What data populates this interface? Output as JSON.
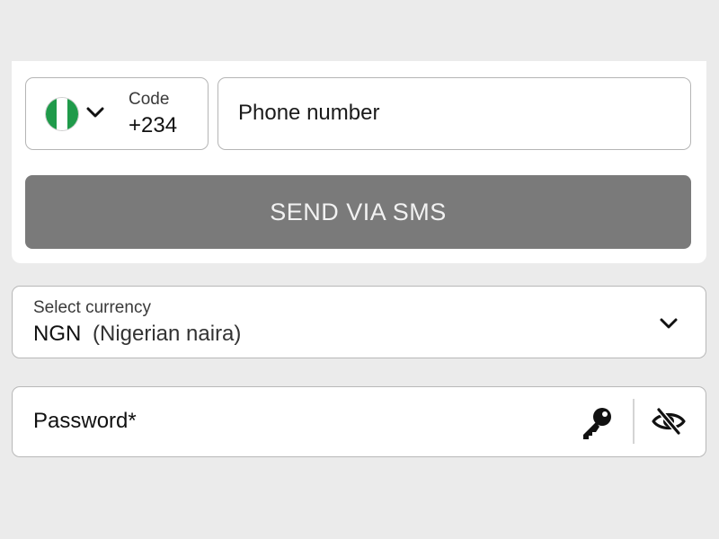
{
  "phone": {
    "code_label": "Code",
    "code_value": "+234",
    "country_flag_icon": "nigeria-flag-icon",
    "flag_colors": [
      "#1f9a4a",
      "#ffffff",
      "#1f9a4a"
    ],
    "placeholder": "Phone number",
    "send_button_label": "SEND VIA SMS",
    "send_button_color": "#7a7a7a"
  },
  "currency": {
    "label": "Select currency",
    "code": "NGN",
    "name": "(Nigerian naira)"
  },
  "password": {
    "placeholder": "Password*",
    "generate_icon": "key-icon",
    "visibility_icon": "eye-slash-icon"
  }
}
